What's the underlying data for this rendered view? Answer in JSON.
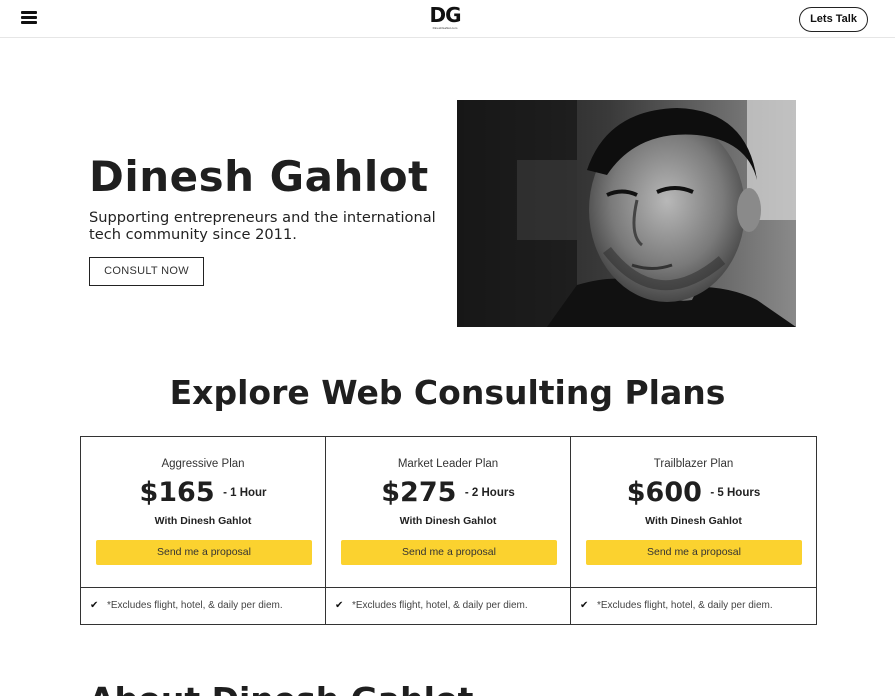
{
  "header": {
    "menu_icon": "hamburger-menu-icon",
    "logo_text": "DG",
    "logo_subtext": "DineshGahlot.com",
    "cta_label": "Lets Talk"
  },
  "hero": {
    "name": "Dinesh Gahlot",
    "tagline": "Supporting entrepreneurs and the international tech community since 2011.",
    "button_label": "CONSULT NOW",
    "photo_alt": "Black and white portrait photo"
  },
  "plans_section": {
    "title": "Explore Web Consulting Plans",
    "plans": [
      {
        "name": "Aggressive Plan",
        "price": "$165",
        "duration": "- 1 Hour",
        "with": "With Dinesh Gahlot",
        "button_label": "Send me a proposal",
        "note": "*Excludes flight, hotel, & daily per diem."
      },
      {
        "name": "Market Leader Plan",
        "price": "$275",
        "duration": "- 2 Hours",
        "with": "With Dinesh Gahlot",
        "button_label": "Send me a proposal",
        "note": "*Excludes flight, hotel, & daily per diem."
      },
      {
        "name": "Trailblazer Plan",
        "price": "$600",
        "duration": "- 5 Hours",
        "with": "With Dinesh Gahlot",
        "button_label": "Send me a proposal",
        "note": "*Excludes flight, hotel, & daily per diem."
      }
    ]
  },
  "about_section": {
    "title": "About Dinesh Gahlot"
  },
  "colors": {
    "accent": "#fbd22f",
    "text": "#1f1f1f",
    "border": "#333333",
    "background": "#ffffff"
  },
  "icons": {
    "check": "check-icon"
  }
}
